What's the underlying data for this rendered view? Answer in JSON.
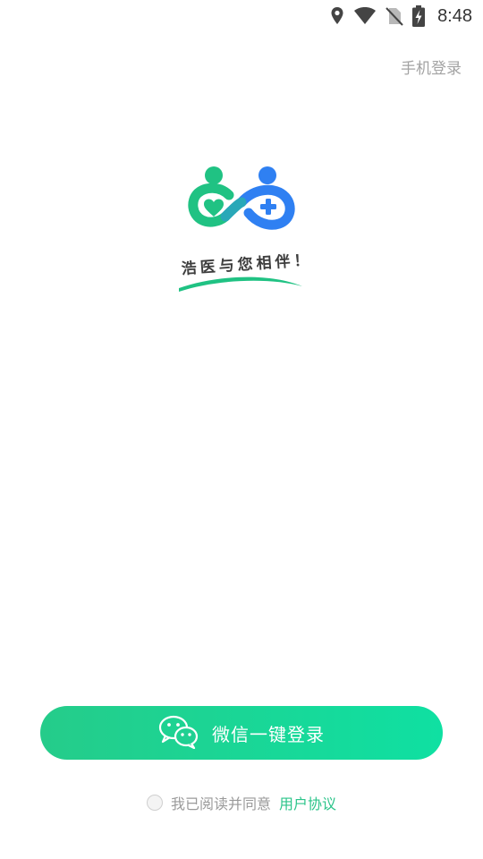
{
  "status_bar": {
    "time": "8:48",
    "icons": [
      "location-icon",
      "wifi-icon",
      "no-sim-icon",
      "battery-charging-icon"
    ]
  },
  "header": {
    "phone_login": "手机登录"
  },
  "logo": {
    "slogan": "浩医与您相伴！",
    "colors": {
      "green": "#20c283",
      "blue": "#2f80f2"
    }
  },
  "login": {
    "wechat_button_label": "微信一键登录",
    "wechat_icon": "wechat-icon",
    "button_color_start": "#25cc8a",
    "button_color_end": "#0fe0a2"
  },
  "agreement": {
    "checked": false,
    "text": "我已阅读并同意",
    "link_label": "用户协议",
    "link_color": "#2bc48a"
  }
}
